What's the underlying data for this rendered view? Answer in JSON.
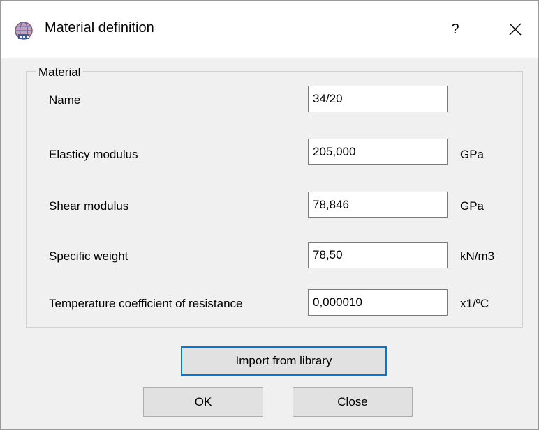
{
  "window": {
    "title": "Material definition",
    "help_label": "?",
    "icon": "app-globe-icon",
    "close_icon": "close-icon"
  },
  "group": {
    "legend": "Material",
    "fields": [
      {
        "label": "Name",
        "value": "34/20",
        "unit": ""
      },
      {
        "label": "Elasticy modulus",
        "value": "205,000",
        "unit": "GPa"
      },
      {
        "label": "Shear modulus",
        "value": "78,846",
        "unit": "GPa"
      },
      {
        "label": "Specific weight",
        "value": "78,50",
        "unit": "kN/m3"
      },
      {
        "label": "Temperature coefficient of resistance",
        "value": "0,000010",
        "unit": "x1/ºC"
      }
    ]
  },
  "buttons": {
    "import_label": "Import from library",
    "ok_label": "OK",
    "close_label": "Close"
  }
}
